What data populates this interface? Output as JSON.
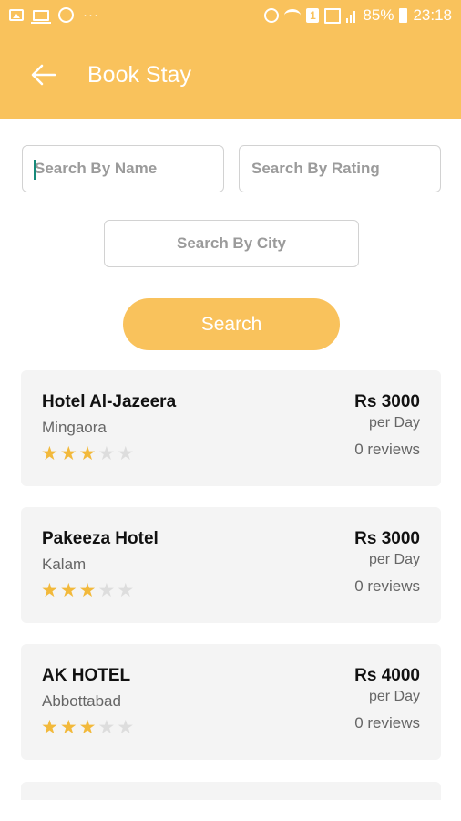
{
  "status_bar": {
    "icons": [
      "image-icon",
      "laptop-icon",
      "whatsapp-icon",
      "more-dots-icon",
      "alarm-icon",
      "wifi-icon",
      "notification-badge-icon",
      "signal-icon",
      "battery-icon"
    ],
    "badge": "1",
    "more": "···",
    "battery": "85%",
    "time": "23:18"
  },
  "header": {
    "title": "Book Stay",
    "back_icon": "arrow-left-icon",
    "color": "#f9c25c"
  },
  "filters": {
    "name_placeholder": "Search By Name",
    "rating_placeholder": "Search By Rating",
    "city_placeholder": "Search By City",
    "search_label": "Search"
  },
  "hotels": [
    {
      "name": "Hotel Al-Jazeera",
      "city": "Mingaora",
      "price": "Rs 3000",
      "per": "per Day",
      "reviews": "0 reviews",
      "rating": 3,
      "max_rating": 5
    },
    {
      "name": "Pakeeza Hotel",
      "city": "Kalam",
      "price": "Rs 3000",
      "per": "per Day",
      "reviews": "0 reviews",
      "rating": 3,
      "max_rating": 5
    },
    {
      "name": "AK HOTEL",
      "city": "Abbottabad",
      "price": "Rs 4000",
      "per": "per Day",
      "reviews": "0 reviews",
      "rating": 3,
      "max_rating": 5
    }
  ],
  "colors": {
    "accent": "#f9c25c",
    "star_on": "#f2b93b",
    "star_off": "#dddddd",
    "card_bg": "#f4f4f4"
  }
}
